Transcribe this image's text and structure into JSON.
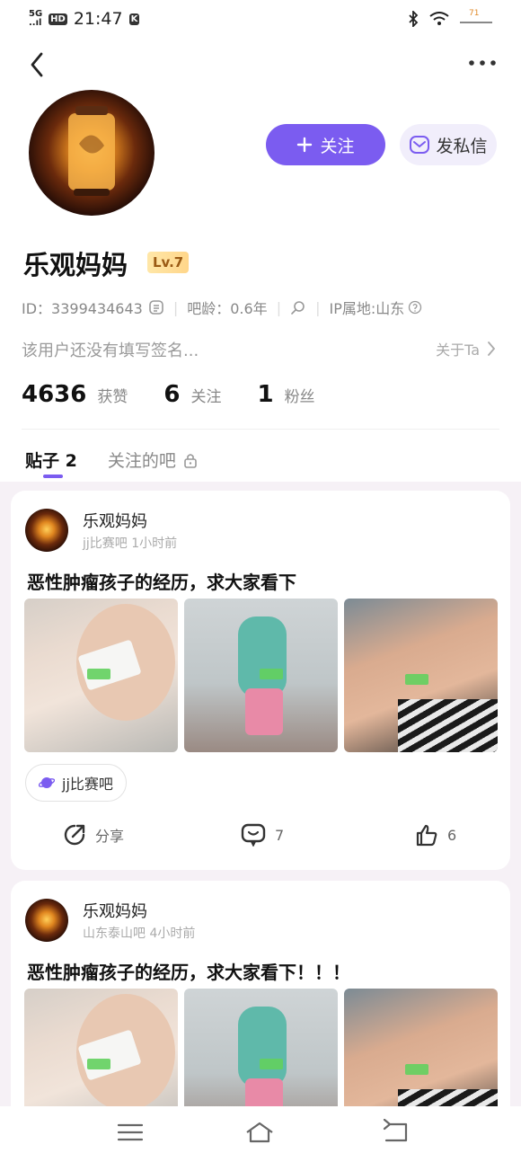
{
  "status_bar": {
    "network": "5G",
    "signal": "..ıl",
    "hd": "HD",
    "time": "21:47",
    "app_badge": "K",
    "battery": "71"
  },
  "profile": {
    "nickname": "乐观妈妈",
    "level": "Lv.7",
    "follow_label": "关注",
    "message_label": "发私信",
    "id_text": "ID：3399434643",
    "age_text": "吧龄：0.6年",
    "ip_text": "IP属地:山东",
    "signature": "该用户还没有填写签名...",
    "about_label": "关于Ta",
    "stats": [
      {
        "num": "4636",
        "label": "获赞"
      },
      {
        "num": "6",
        "label": "关注"
      },
      {
        "num": "1",
        "label": "粉丝"
      }
    ]
  },
  "tabs": [
    {
      "label": "贴子 2"
    },
    {
      "label": "关注的吧"
    }
  ],
  "posts": [
    {
      "author": "乐观妈妈",
      "meta": "jj比赛吧  1小时前",
      "title": "恶性肿瘤孩子的经历，求大家看下",
      "forum": "jj比赛吧",
      "share_label": "分享",
      "comments": "7",
      "likes": "6"
    },
    {
      "author": "乐观妈妈",
      "meta": "山东泰山吧  4小时前",
      "title": "恶性肿瘤孩子的经历，求大家看下！！！"
    }
  ],
  "colors": {
    "accent": "#7b5cf0",
    "feed_bg": "#f6f1f6",
    "level_badge": "#ffd68a"
  }
}
